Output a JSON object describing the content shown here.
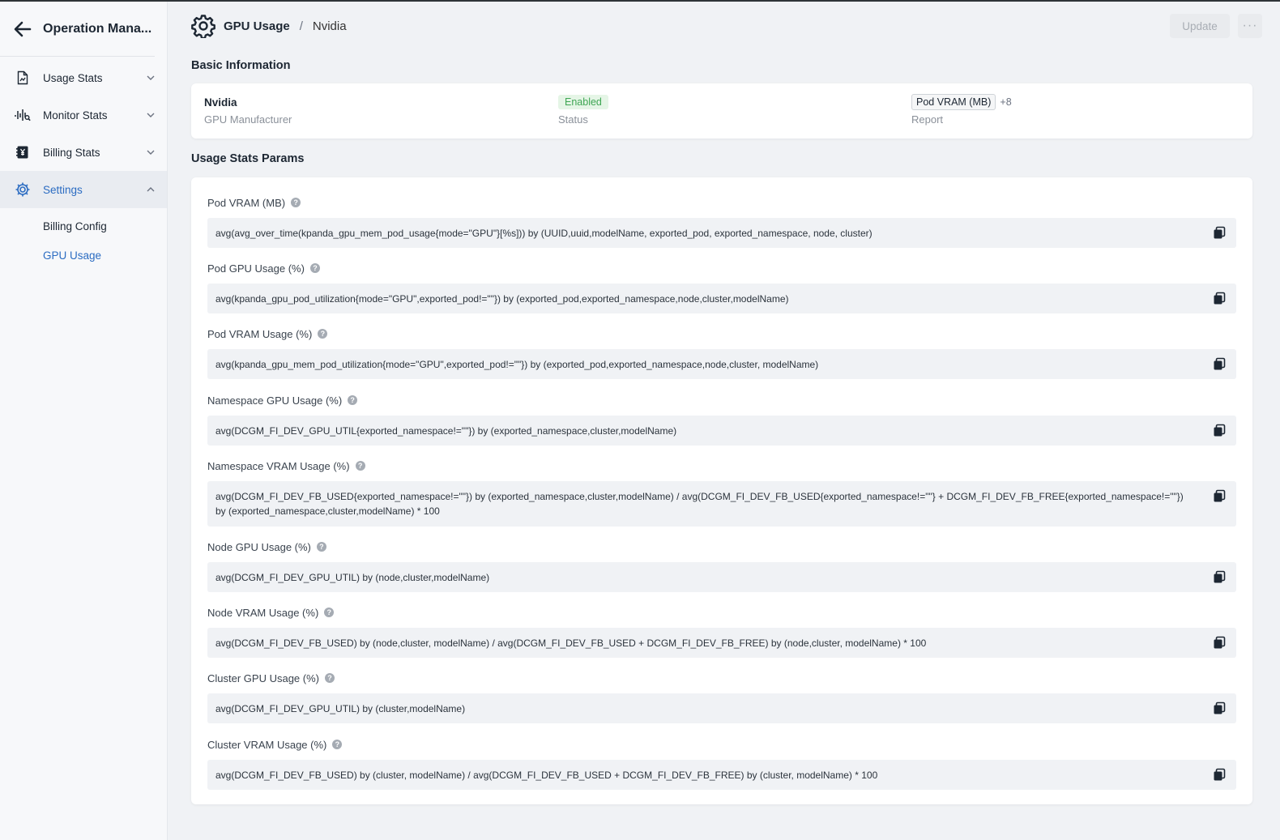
{
  "sidebar": {
    "title": "Operation Mana...",
    "items": [
      {
        "label": "Usage Stats",
        "icon": "document-chart-icon"
      },
      {
        "label": "Monitor Stats",
        "icon": "monitor-waveform-icon"
      },
      {
        "label": "Billing Stats",
        "icon": "billing-yen-icon"
      },
      {
        "label": "Settings",
        "icon": "gear-icon"
      }
    ],
    "subitems": [
      "Billing Config",
      "GPU Usage"
    ]
  },
  "header": {
    "crumb_main": "GPU Usage",
    "crumb_sep": "/",
    "crumb_sub": "Nvidia",
    "update_label": "Update",
    "more_label": "···"
  },
  "basic": {
    "title": "Basic Information",
    "manufacturer_value": "Nvidia",
    "manufacturer_label": "GPU Manufacturer",
    "status_value": "Enabled",
    "status_label": "Status",
    "report_tag": "Pod VRAM (MB)",
    "report_more": "+8",
    "report_label": "Report"
  },
  "params": {
    "title": "Usage Stats Params",
    "items": [
      {
        "label": "Pod VRAM (MB)",
        "value": "avg(avg_over_time(kpanda_gpu_mem_pod_usage{mode=\"GPU\"}[%s])) by (UUID,uuid,modelName, exported_pod, exported_namespace, node, cluster)"
      },
      {
        "label": "Pod GPU Usage (%)",
        "value": "avg(kpanda_gpu_pod_utilization{mode=\"GPU\",exported_pod!=\"\"}) by (exported_pod,exported_namespace,node,cluster,modelName)"
      },
      {
        "label": "Pod VRAM Usage (%)",
        "value": "avg(kpanda_gpu_mem_pod_utilization{mode=\"GPU\",exported_pod!=\"\"}) by (exported_pod,exported_namespace,node,cluster, modelName)"
      },
      {
        "label": "Namespace GPU Usage (%)",
        "value": "avg(DCGM_FI_DEV_GPU_UTIL{exported_namespace!=\"\"}) by (exported_namespace,cluster,modelName)"
      },
      {
        "label": "Namespace VRAM Usage (%)",
        "value": "avg(DCGM_FI_DEV_FB_USED{exported_namespace!=\"\"}) by (exported_namespace,cluster,modelName) / avg(DCGM_FI_DEV_FB_USED{exported_namespace!=\"\"} + DCGM_FI_DEV_FB_FREE{exported_namespace!=\"\"}) by (exported_namespace,cluster,modelName) * 100"
      },
      {
        "label": "Node GPU Usage (%)",
        "value": "avg(DCGM_FI_DEV_GPU_UTIL) by (node,cluster,modelName)"
      },
      {
        "label": "Node VRAM Usage (%)",
        "value": "avg(DCGM_FI_DEV_FB_USED) by (node,cluster, modelName) / avg(DCGM_FI_DEV_FB_USED + DCGM_FI_DEV_FB_FREE) by (node,cluster, modelName) * 100"
      },
      {
        "label": "Cluster GPU Usage (%)",
        "value": "avg(DCGM_FI_DEV_GPU_UTIL) by (cluster,modelName)"
      },
      {
        "label": "Cluster VRAM Usage (%)",
        "value": "avg(DCGM_FI_DEV_FB_USED) by (cluster, modelName) / avg(DCGM_FI_DEV_FB_USED + DCGM_FI_DEV_FB_FREE) by (cluster, modelName) * 100"
      }
    ]
  },
  "colors": {
    "accent": "#2b6cc2",
    "status_green": "#3fa654"
  }
}
